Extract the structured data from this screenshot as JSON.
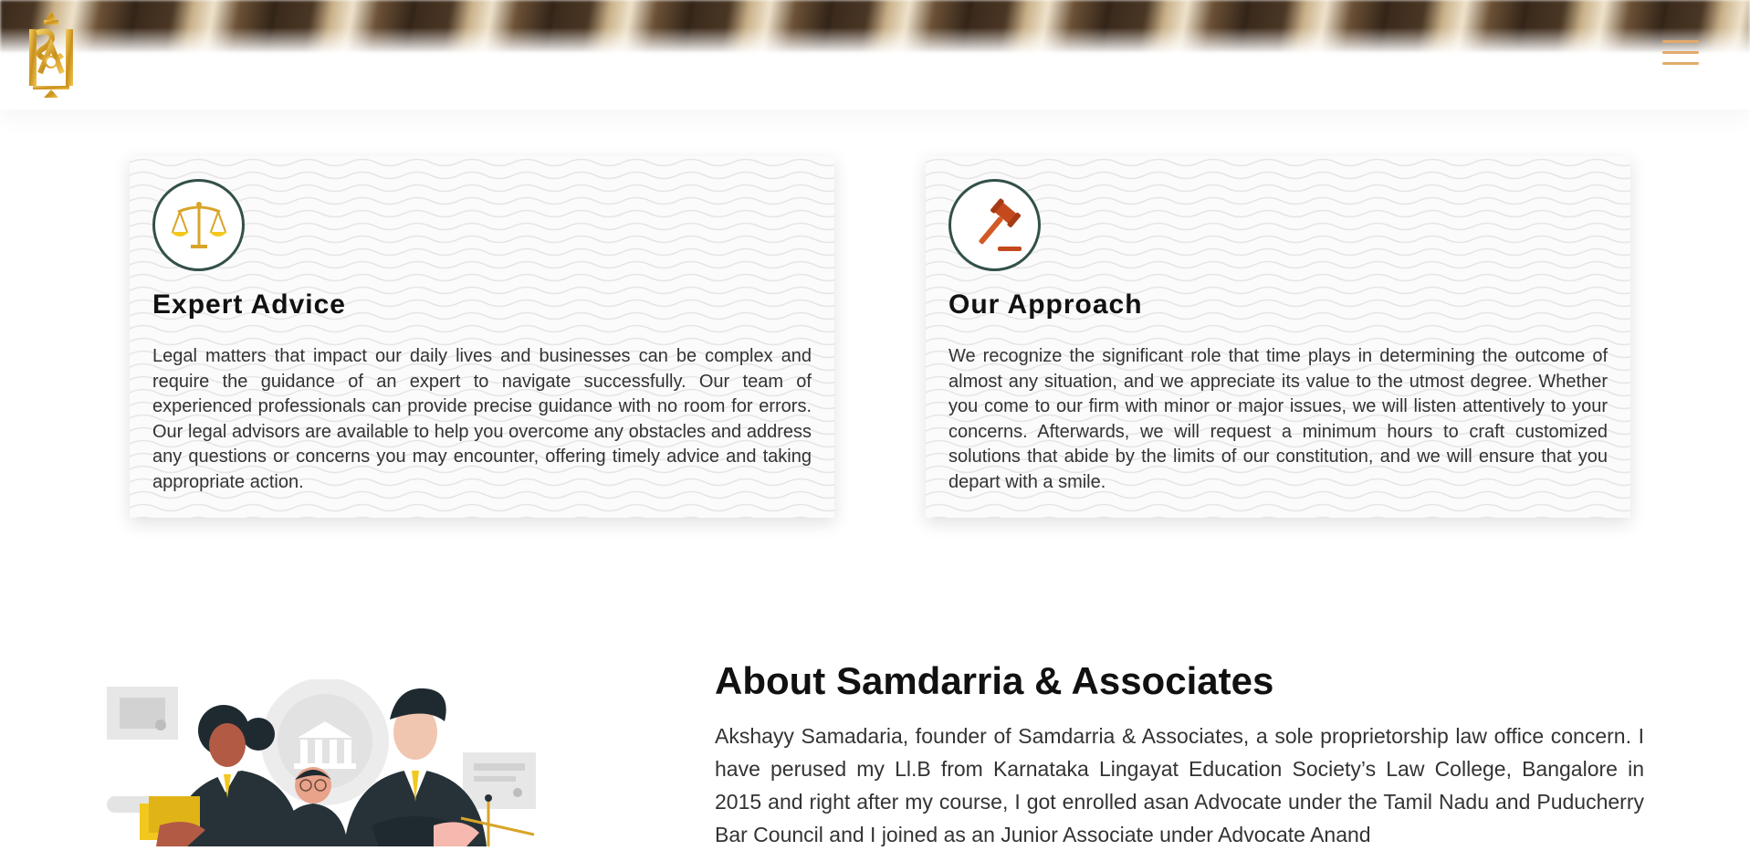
{
  "header": {
    "logo_icon": "law-firm-monogram-logo",
    "menu_icon": "hamburger-menu-icon",
    "accent_color": "#e2aa6a",
    "gold_color": "#d8a529"
  },
  "cards": [
    {
      "icon": "scales-of-justice-icon",
      "title": "Expert Advice",
      "text": "Legal matters that impact our daily lives and businesses can be complex and require the guidance of an expert to navigate successfully. Our team of experienced professionals can provide precise guidance with no room for errors. Our legal advisors are available to help you overcome any obstacles and address any questions or concerns you may encounter, offering timely advice and taking appropriate action."
    },
    {
      "icon": "gavel-icon",
      "title": "Our Approach",
      "text": "We recognize the significant role that time plays in determining the outcome of almost any situation, and we appreciate its value to the utmost degree. Whether you come to our firm with minor or major issues, we will listen attentively to your concerns. Afterwards, we will request a minimum hours to craft customized solutions that abide by the limits of our constitution, and we will ensure that you depart with a smile."
    }
  ],
  "about": {
    "title": "About Samdarria & Associates",
    "text": "Akshayy Samadaria, founder of Samdarria & Associates, a sole proprietorship law office concern. I have perused my Ll.B from Karnataka Lingayat Education Society’s Law College, Bangalore in 2015 and right after my course, I got enrolled asan Advocate under the Tamil Nadu and Puducherry Bar Council and I joined as an Junior Associate under Advocate Anand"
  }
}
